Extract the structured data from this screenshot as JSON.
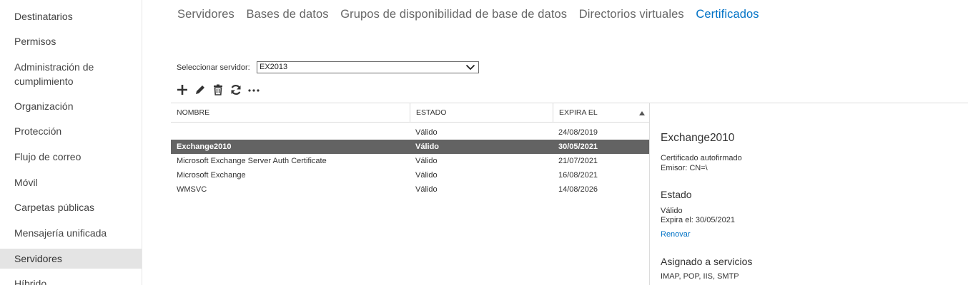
{
  "sidebar": {
    "items": [
      {
        "label": "Destinatarios"
      },
      {
        "label": "Permisos"
      },
      {
        "label": "Administración de cumplimiento"
      },
      {
        "label": "Organización"
      },
      {
        "label": "Protección"
      },
      {
        "label": "Flujo de correo"
      },
      {
        "label": "Móvil"
      },
      {
        "label": "Carpetas públicas"
      },
      {
        "label": "Mensajería unificada"
      },
      {
        "label": "Servidores",
        "selected": true
      },
      {
        "label": "Híbrido"
      }
    ]
  },
  "tabs": [
    {
      "label": "Servidores"
    },
    {
      "label": "Bases de datos"
    },
    {
      "label": "Grupos de disponibilidad de base de datos"
    },
    {
      "label": "Directorios virtuales"
    },
    {
      "label": "Certificados",
      "active": true
    }
  ],
  "server_select": {
    "label": "Seleccionar servidor:",
    "value": "EX2013"
  },
  "toolbar": {
    "icons": [
      "add-icon",
      "edit-icon",
      "delete-icon",
      "refresh-icon",
      "more-icon"
    ]
  },
  "table": {
    "columns": [
      "NOMBRE",
      "ESTADO",
      "EXPIRA EL"
    ],
    "sort_column": "EXPIRA EL",
    "sort_direction": "ascending",
    "rows": [
      {
        "name": "",
        "state": "Válido",
        "expires": "24/08/2019"
      },
      {
        "name": "Exchange2010",
        "state": "Válido",
        "expires": "30/05/2021",
        "selected": true
      },
      {
        "name": "Microsoft Exchange Server Auth Certificate",
        "state": "Válido",
        "expires": "21/07/2021"
      },
      {
        "name": "Microsoft Exchange",
        "state": "Válido",
        "expires": "16/08/2021"
      },
      {
        "name": "WMSVC",
        "state": "Válido",
        "expires": "14/08/2026"
      }
    ]
  },
  "details": {
    "title": "Exchange2010",
    "type_text": "Certificado autofirmado",
    "issuer_text": "Emisor: CN=\\",
    "status_heading": "Estado",
    "status_value": "Válido",
    "expires_text": "Expira el: 30/05/2021",
    "renew_link": "Renovar",
    "services_heading": "Asignado a servicios",
    "services_value": "IMAP, POP, IIS, SMTP"
  },
  "colors": {
    "accent": "#0072c6",
    "selected_row": "#636363",
    "sidebar_selected": "#e4e4e4"
  }
}
